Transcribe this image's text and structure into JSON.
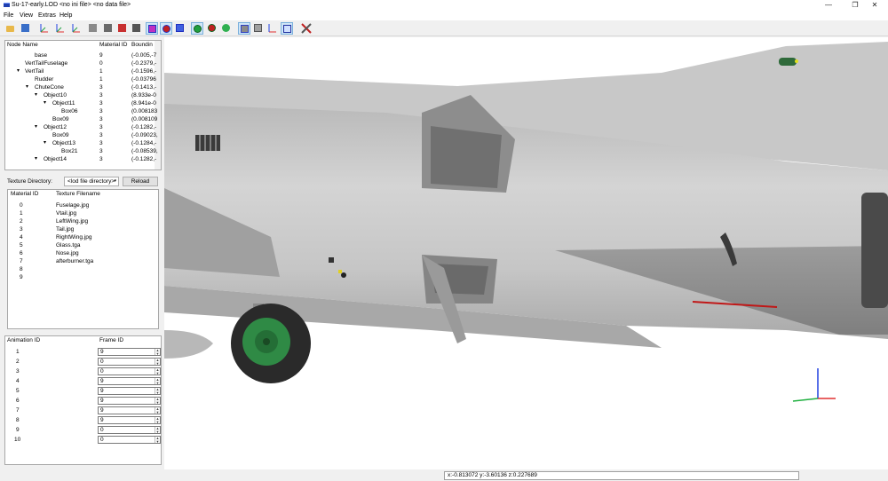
{
  "window": {
    "title": "Su-17-early.LOD  <no ini file>  <no data file>",
    "minimize_glyph": "—",
    "maximize_glyph": "❐",
    "close_glyph": "✕"
  },
  "menu": {
    "file": "File",
    "view": "View",
    "extras": "Extras",
    "help": "Help"
  },
  "toolbar": {
    "icons": [
      "open-folder-icon",
      "save-icon",
      "axis-xyz-red-icon",
      "axis-xyz-green-icon",
      "axis-xyz-multi-icon",
      "gray-cube-icon",
      "dark-cube-icon",
      "red-cube-icon",
      "shaded-cube-icon",
      "blue-wireframe-cube-icon",
      "red-sphere-cube-icon",
      "blue-sphere-cube-icon",
      "green-circle-icon",
      "red-circle-icon",
      "green-dot-icon",
      "gray-cube-layered-icon",
      "gray-cube-stack-icon",
      "axis-icon",
      "bounding-box-icon",
      "tools-icon"
    ]
  },
  "node_tree": {
    "columns": [
      "Node Name",
      "Material ID",
      "Boundin"
    ],
    "rows": [
      {
        "name": "base",
        "material": "9",
        "bounding": "(-0.005,-7",
        "level": 3,
        "toggle": ""
      },
      {
        "name": "VertTailFuselage",
        "material": "0",
        "bounding": "(-0.2379,-",
        "level": 1,
        "toggle": ""
      },
      {
        "name": "VertTail",
        "material": "1",
        "bounding": "(-0.1596,-",
        "level": 1,
        "toggle": "v"
      },
      {
        "name": "Rudder",
        "material": "1",
        "bounding": "(-0.03796",
        "level": 2,
        "toggle": ""
      },
      {
        "name": "ChuteCone",
        "material": "3",
        "bounding": "(-0.1413,-",
        "level": 2,
        "toggle": "v"
      },
      {
        "name": "Object10",
        "material": "3",
        "bounding": "(8.933e-0",
        "level": 3,
        "toggle": "v"
      },
      {
        "name": "Object11",
        "material": "3",
        "bounding": "(8.941e-0",
        "level": 4,
        "toggle": "v"
      },
      {
        "name": "Box06",
        "material": "3",
        "bounding": "(0.008183",
        "level": 5,
        "toggle": ""
      },
      {
        "name": "Box09",
        "material": "3",
        "bounding": "(0.008109",
        "level": 4,
        "toggle": ""
      },
      {
        "name": "Object12",
        "material": "3",
        "bounding": "(-0.1282,-",
        "level": 3,
        "toggle": "v"
      },
      {
        "name": "Box09",
        "material": "3",
        "bounding": "(-0.09023,",
        "level": 4,
        "toggle": ""
      },
      {
        "name": "Object13",
        "material": "3",
        "bounding": "(-0.1284,-",
        "level": 4,
        "toggle": "v"
      },
      {
        "name": "Box21",
        "material": "3",
        "bounding": "(-0.08539,",
        "level": 5,
        "toggle": ""
      },
      {
        "name": "Object14",
        "material": "3",
        "bounding": "(-0.1282,-",
        "level": 3,
        "toggle": "v"
      }
    ]
  },
  "texture": {
    "directory_label": "Texture Directory:",
    "directory_value": "<lod file directory>",
    "reload_label": "Reload",
    "columns": [
      "Material ID",
      "Texture Filename"
    ],
    "rows": [
      {
        "id": "0",
        "file": "Fuselage.jpg"
      },
      {
        "id": "1",
        "file": "Vtail.jpg"
      },
      {
        "id": "2",
        "file": "LeftWing.jpg"
      },
      {
        "id": "3",
        "file": "Tail.jpg"
      },
      {
        "id": "4",
        "file": "RightWing.jpg"
      },
      {
        "id": "5",
        "file": "Glass.tga"
      },
      {
        "id": "6",
        "file": "Nose.jpg"
      },
      {
        "id": "7",
        "file": "afterburner.tga"
      },
      {
        "id": "8",
        "file": ""
      },
      {
        "id": "9",
        "file": ""
      }
    ]
  },
  "animation": {
    "columns": [
      "Animation ID",
      "Frame ID"
    ],
    "rows": [
      {
        "id": "1",
        "frame": "9"
      },
      {
        "id": "2",
        "frame": "0"
      },
      {
        "id": "3",
        "frame": "0"
      },
      {
        "id": "4",
        "frame": "9"
      },
      {
        "id": "5",
        "frame": "9"
      },
      {
        "id": "6",
        "frame": "9"
      },
      {
        "id": "7",
        "frame": "9"
      },
      {
        "id": "8",
        "frame": "9"
      },
      {
        "id": "9",
        "frame": "0"
      },
      {
        "id": "10",
        "frame": "0"
      }
    ]
  },
  "status": {
    "coordinates": "x:-0.813072 y:-3.60136 z:0.227689"
  },
  "colors": {
    "accent_blue": "#1f3fb0",
    "wheel_green": "#2f8a45",
    "axis_x": "#e03030",
    "axis_y": "#20b040",
    "axis_z": "#2040e0"
  }
}
